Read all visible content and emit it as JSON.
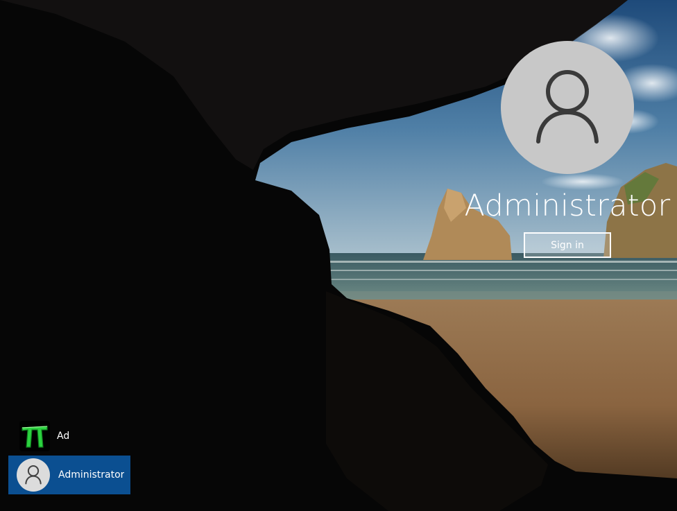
{
  "login": {
    "username": "Administrator",
    "sign_in_label": "Sign in"
  },
  "user_list": [
    {
      "label": "Ad",
      "icon": "pi-user-icon",
      "selected": false
    },
    {
      "label": "Administrator",
      "icon": "user-icon",
      "selected": true
    }
  ],
  "colors": {
    "selected_tile": "#0b4f91",
    "avatar_bg": "#c8c8c8",
    "text": "#ffffff"
  }
}
